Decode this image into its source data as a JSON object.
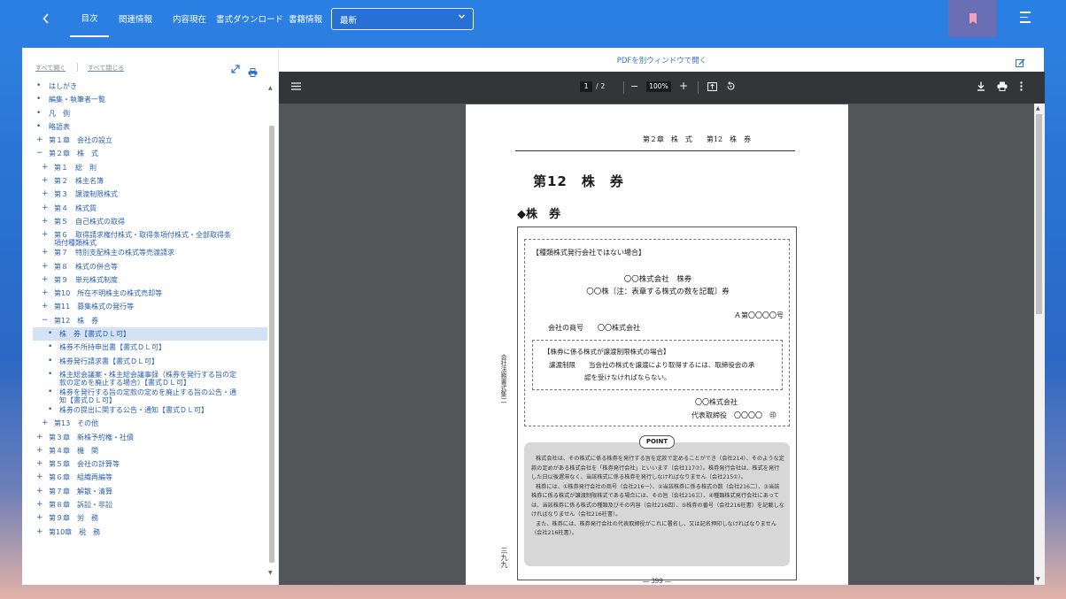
{
  "topbar": {
    "back_icon": "chevron-left-icon",
    "tabs": [
      {
        "label": "目次",
        "active": true
      },
      {
        "label": "関連情報",
        "active": false
      },
      {
        "label": "内容現在",
        "active": false
      },
      {
        "label": "書式ダウンロード",
        "active": false
      },
      {
        "label": "書籍情報",
        "active": false
      }
    ],
    "version_select": "最新",
    "bookmark_icon": "bookmark-icon",
    "menu_icon": "menu-icon",
    "accent": "#2a7fe3",
    "bookmark_bg": "#6a6fb5"
  },
  "sidebar": {
    "expand_all": "すべて開く",
    "collapse_all": "すべて閉じる",
    "toc": [
      {
        "marker": "•",
        "label": "はしがき",
        "depth": 0
      },
      {
        "marker": "•",
        "label": "編集・執筆者一覧",
        "depth": 0
      },
      {
        "marker": "•",
        "label": "凡　例",
        "depth": 0
      },
      {
        "marker": "•",
        "label": "略語表",
        "depth": 0
      },
      {
        "marker": "+",
        "label": "第１章　会社の設立",
        "depth": 0
      },
      {
        "marker": "−",
        "label": "第２章　株　式",
        "depth": 0
      },
      {
        "marker": "+",
        "label": "第１　総　則",
        "depth": 1
      },
      {
        "marker": "+",
        "label": "第２　株主名簿",
        "depth": 1
      },
      {
        "marker": "+",
        "label": "第３　譲渡制限株式",
        "depth": 1
      },
      {
        "marker": "+",
        "label": "第４　株式質",
        "depth": 1
      },
      {
        "marker": "+",
        "label": "第５　自己株式の取得",
        "depth": 1
      },
      {
        "marker": "+",
        "label": "第６　取得請求権付株式・取得条項付株式・全部取得条",
        "label2": "項付種類株式",
        "depth": 1
      },
      {
        "marker": "+",
        "label": "第７　特別支配株主の株式等売渡請求",
        "depth": 1
      },
      {
        "marker": "+",
        "label": "第８　株式の併合等",
        "depth": 1
      },
      {
        "marker": "+",
        "label": "第９　単元株式制度",
        "depth": 1
      },
      {
        "marker": "+",
        "label": "第10　所在不明株主の株式売却等",
        "depth": 1
      },
      {
        "marker": "+",
        "label": "第11　募集株式の発行等",
        "depth": 1
      },
      {
        "marker": "−",
        "label": "第12　株　券",
        "depth": 1
      },
      {
        "marker": "•",
        "label": "株　券【書式ＤＬ可】",
        "depth": 2,
        "highlight": true
      },
      {
        "marker": "•",
        "label": "株券不所持申出書【書式ＤＬ可】",
        "depth": 2
      },
      {
        "marker": "•",
        "label": "株券発行請求書【書式ＤＬ可】",
        "depth": 2
      },
      {
        "marker": "•",
        "label": "株主総会議案・株主総会議事録（株券を発行する旨の定",
        "label2": "款の定めを廃止する場合）【書式ＤＬ可】",
        "depth": 2
      },
      {
        "marker": "•",
        "label": "株券を発行する旨の定款の定めを廃止する旨の公告・通",
        "label2": "知【書式ＤＬ可】",
        "depth": 2
      },
      {
        "marker": "•",
        "label": "株券の提出に関する公告・通知【書式ＤＬ可】",
        "depth": 2
      },
      {
        "marker": "+",
        "label": "第13　その他",
        "depth": 1
      },
      {
        "marker": "+",
        "label": "第３章　新株予約権・社債",
        "depth": 0
      },
      {
        "marker": "+",
        "label": "第４章　機　関",
        "depth": 0
      },
      {
        "marker": "+",
        "label": "第５章　会社の計算等",
        "depth": 0
      },
      {
        "marker": "+",
        "label": "第６章　組織再編等",
        "depth": 0
      },
      {
        "marker": "+",
        "label": "第７章　解散・清算",
        "depth": 0
      },
      {
        "marker": "+",
        "label": "第８章　訴訟・非訟",
        "depth": 0
      },
      {
        "marker": "+",
        "label": "第９章　労　務",
        "depth": 0
      },
      {
        "marker": "+",
        "label": "第10章　税　務",
        "depth": 0
      }
    ]
  },
  "viewer": {
    "open_pdf_link": "PDFを別ウィンドウで開く",
    "page_current": "1",
    "page_total": "/ 2",
    "zoom": "100%",
    "minus": "−",
    "plus": "+"
  },
  "pdf_page": {
    "running_header": "第２章　株　式　　第12　株　券",
    "chapter_title": "第12　株　券",
    "section_title": "◆株　券",
    "side_text": "会社法務書式集二",
    "side_page": "三九九",
    "form": {
      "head": "【種類株式発行会社ではない場合】",
      "line1": "〇〇株式会社　株券",
      "line2": "〇〇株〔注：表章する株式の数を記載〕券",
      "number": "Ａ第〇〇〇〇号",
      "company": "会社の商号　　〇〇株式会社",
      "inner_head": "【株券に係る株式が譲渡制限株式の場合】",
      "inner_line1": "譲渡制限　　当会社の株式を譲渡により取得するには、取締役会の承",
      "inner_line2": "認を受けなければならない。",
      "sign1": "〇〇株式会社",
      "sign2": "代表取締役　〇〇〇〇　㊞"
    },
    "point_label": "POINT",
    "point_paragraphs": [
      "株式会社は、その株式に係る株券を発行する旨を定款で定めることができ（会社214）、そのような定款の定めがある株式会社を「株券発行会社」といいます（会社117⑦）。株券発行会社は、株式を発行した日以後遅滞なく、当該株式に係る株券を発行しなければなりません（会社215①）。",
      "株券には、①株券発行会社の商号（会社216一）、②当該株券に係る株式の数（会社216二）、③当該株券に係る株式が譲渡制限株式である場合には、その旨（会社216三）、④種類株式発行会社にあっては、当該株券に係る株式の種類及びその内容（会社216四）、⑤株券の番号（会社216柱書）を記載しなければなりません（会社216柱書）。",
      "また、株券には、株券発行会社の代表取締役がこれに署名し、又は記名押印しなければなりません（会社216柱書）。"
    ],
    "page_footer": "― 399 ―"
  }
}
